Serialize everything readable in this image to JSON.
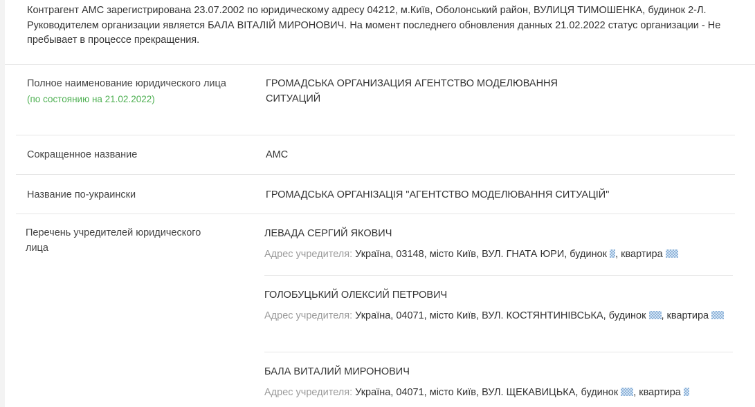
{
  "summary": "Контрагент АМС зарегистрирована 23.07.2002 по юридическому адресу 04212, м.Київ, Оболонський район, ВУЛИЦЯ ТИМОШЕНКА, будинок 2-Л. Руководителем организации является БАЛА ВІТАЛІЙ МИРОНОВИЧ. На момент последнего обновления данных 21.02.2022 статус организации - Не пребывает в процессе прекращения.",
  "full_name": {
    "label": "Полное наименование юридического лица",
    "date_note": "(по состоянию на 21.02.2022)",
    "value": "ГРОМАДСЬКА ОРГАНИЗАЦИЯ АГЕНТСТВО МОДЕЛЮВАННЯ СИТУАЦИЙ"
  },
  "short_name": {
    "label": "Сокращенное название",
    "value": "АМС"
  },
  "ukrainian_name": {
    "label": "Название по-украински",
    "value": "ГРОМАДСЬКА ОРГАНІЗАЦІЯ \"АГЕНТСТВО МОДЕЛЮВАННЯ СИТУАЦІЙ\""
  },
  "founders": {
    "label": "Перечень учредителей юридического лица",
    "address_label": "Адрес учредителя:",
    "items": [
      {
        "name": "ЛЕВАДА СЕРГИЙ ЯКОВИЧ",
        "address_start": "Україна, 03148, місто Київ, ВУЛ. ГНАТА ЮРИ, будинок",
        "address_mid": ", квартира"
      },
      {
        "name": "ГОЛОБУЦЬКИЙ ОЛЕКСИЙ ПЕТРОВИЧ",
        "address_start": "Україна, 04071, місто Київ, ВУЛ. КОСТЯНТИНІВСЬКА, будинок",
        "address_mid": ", квартира"
      },
      {
        "name": "БАЛА ВИТАЛИЙ МИРОНОВИЧ",
        "address_start": "Україна, 04071, місто Київ, ВУЛ. ЩЕКАВИЦЬКА, будинок",
        "address_mid": ", квартира"
      }
    ]
  },
  "colors": {
    "date_note": "#4caf50",
    "address_label": "#9a9a9a",
    "text": "#333333",
    "divider": "#e6e6e6"
  }
}
